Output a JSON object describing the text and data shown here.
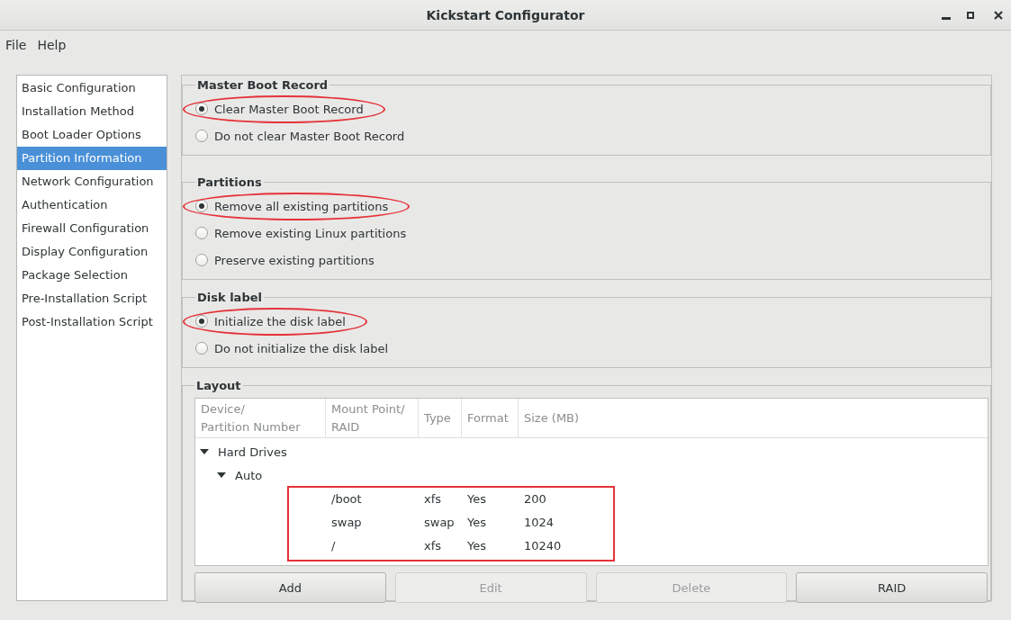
{
  "window": {
    "title": "Kickstart Configurator"
  },
  "menu": [
    {
      "label": "File"
    },
    {
      "label": "Help"
    }
  ],
  "sidebar": {
    "items": [
      {
        "label": "Basic Configuration",
        "selected": false
      },
      {
        "label": "Installation Method",
        "selected": false
      },
      {
        "label": "Boot Loader Options",
        "selected": false
      },
      {
        "label": "Partition Information",
        "selected": true
      },
      {
        "label": "Network Configuration",
        "selected": false
      },
      {
        "label": "Authentication",
        "selected": false
      },
      {
        "label": "Firewall Configuration",
        "selected": false
      },
      {
        "label": "Display Configuration",
        "selected": false
      },
      {
        "label": "Package Selection",
        "selected": false
      },
      {
        "label": "Pre-Installation Script",
        "selected": false
      },
      {
        "label": "Post-Installation Script",
        "selected": false
      }
    ]
  },
  "sections": [
    {
      "title": "Master Boot Record",
      "options": [
        {
          "label": "Clear Master Boot Record",
          "selected": true,
          "circled": true
        },
        {
          "label": "Do not clear Master Boot Record",
          "selected": false,
          "circled": false
        }
      ]
    },
    {
      "title": "Partitions",
      "options": [
        {
          "label": "Remove all existing partitions",
          "selected": true,
          "circled": true
        },
        {
          "label": "Remove existing Linux partitions",
          "selected": false,
          "circled": false
        },
        {
          "label": "Preserve existing partitions",
          "selected": false,
          "circled": false
        }
      ]
    },
    {
      "title": "Disk label",
      "options": [
        {
          "label": "Initialize the disk label",
          "selected": true,
          "circled": true
        },
        {
          "label": "Do not initialize the disk label",
          "selected": false,
          "circled": false
        }
      ]
    }
  ],
  "layout": {
    "title": "Layout",
    "columns": [
      "Device/\nPartition Number",
      "Mount Point/\nRAID",
      "Type",
      "Format",
      "Size (MB)"
    ],
    "tree": [
      {
        "label": "Hard Drives",
        "expanded": true,
        "children": [
          {
            "label": "Auto",
            "expanded": true,
            "boxed": true,
            "children": [
              {
                "cells": [
                  "/boot",
                  "xfs",
                  "Yes",
                  "200"
                ]
              },
              {
                "cells": [
                  "swap",
                  "swap",
                  "Yes",
                  "1024"
                ]
              },
              {
                "cells": [
                  "/",
                  "xfs",
                  "Yes",
                  "10240"
                ]
              }
            ]
          }
        ]
      }
    ],
    "buttons": [
      {
        "label": "Add",
        "disabled": false
      },
      {
        "label": "Edit",
        "disabled": true
      },
      {
        "label": "Delete",
        "disabled": true
      },
      {
        "label": "RAID",
        "disabled": false
      }
    ]
  }
}
